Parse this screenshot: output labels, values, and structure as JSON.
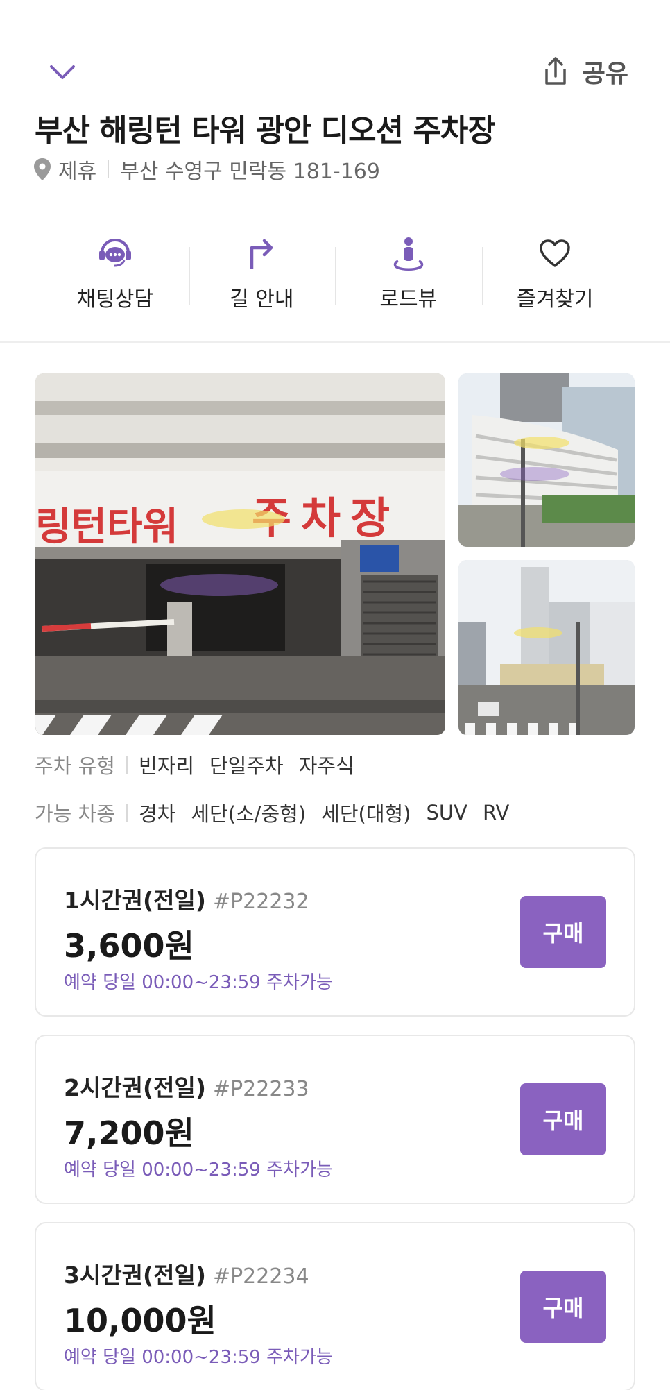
{
  "header": {
    "share_label": "공유",
    "title": "부산 해링턴 타워 광안 디오션 주차장",
    "partner_tag": "제휴",
    "address": "부산 수영구 민락동 181-169"
  },
  "actions": [
    {
      "label": "채팅상담",
      "icon": "chat-headset-icon"
    },
    {
      "label": "길 안내",
      "icon": "turn-right-arrow-icon"
    },
    {
      "label": "로드뷰",
      "icon": "street-view-person-icon"
    },
    {
      "label": "즐겨찾기",
      "icon": "heart-icon"
    }
  ],
  "photo_sign_text": {
    "tower": "링턴타워",
    "parking": "주차장"
  },
  "info": {
    "parking_type_label": "주차 유형",
    "parking_types": [
      "빈자리",
      "단일주차",
      "자주식"
    ],
    "vehicle_label": "가능 차종",
    "vehicles": [
      "경차",
      "세단(소/중형)",
      "세단(대형)",
      "SUV",
      "RV"
    ]
  },
  "tickets": [
    {
      "name": "1시간권(전일)",
      "code": "#P22232",
      "price": "3,600원",
      "note": "예약 당일 00:00~23:59 주차가능",
      "buy_label": "구매"
    },
    {
      "name": "2시간권(전일)",
      "code": "#P22233",
      "price": "7,200원",
      "note": "예약 당일 00:00~23:59 주차가능",
      "buy_label": "구매"
    },
    {
      "name": "3시간권(전일)",
      "code": "#P22234",
      "price": "10,000원",
      "note": "예약 당일 00:00~23:59 주차가능",
      "buy_label": "구매"
    }
  ],
  "colors": {
    "accent": "#8a62c0",
    "note_text": "#7a5cb8"
  }
}
